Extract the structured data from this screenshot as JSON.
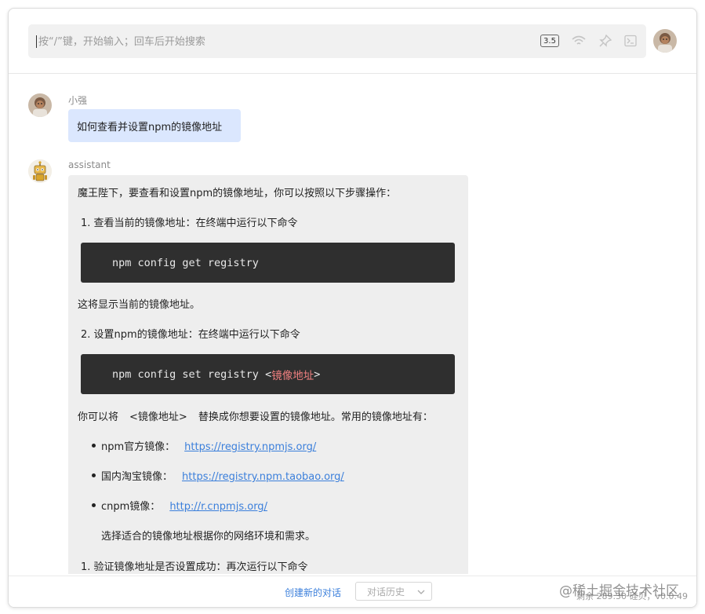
{
  "header": {
    "search_placeholder": "按“/”键，开始输入；回车后开始搜索",
    "model_badge": "3.5",
    "icons": [
      "wifi-icon",
      "pin-icon",
      "terminal-icon"
    ]
  },
  "chat": {
    "user": {
      "name": "小强",
      "message": "如何查看并设置npm的镜像地址"
    },
    "assistant": {
      "name": "assistant",
      "intro": "魔王陛下，要查看和设置npm的镜像地址，你可以按照以下步骤操作：",
      "step1": "1.  查看当前的镜像地址：在终端中运行以下命令",
      "code1": "npm config get registry",
      "after_code1": "这将显示当前的镜像地址。",
      "step2": "2.  设置npm的镜像地址：在终端中运行以下命令",
      "code2_prefix": "npm config set registry <",
      "code2_accent": "镜像地址",
      "code2_suffix": ">",
      "replace_pre": "你可以将",
      "replace_code": "<镜像地址>",
      "replace_post": "替换成你想要设置的镜像地址。常用的镜像地址有：",
      "mirrors": [
        {
          "label": "npm官方镜像：",
          "url": "https://registry.npmjs.org/"
        },
        {
          "label": "国内淘宝镜像：",
          "url": "https://registry.npm.taobao.org/"
        },
        {
          "label": "cnpm镜像：",
          "url": "http://r.cnpmjs.org/"
        }
      ],
      "choose_note": "选择适合的镜像地址根据你的网络环境和需求。",
      "step3": "1.  验证镜像地址是否设置成功：再次运行以下命令"
    }
  },
  "footer": {
    "new_chat": "创建新的对话",
    "history": "对话历史",
    "balance": "剩余 289.30 硅贝，v0.0.49",
    "watermark": "@稀土掘金技术社区"
  },
  "colors": {
    "accent": "#3b7fdb",
    "user_bubble": "#dbe7fe",
    "bot_bubble": "#eeeeee",
    "code_bg": "#2f2f2f",
    "code_accent": "#f08080"
  }
}
